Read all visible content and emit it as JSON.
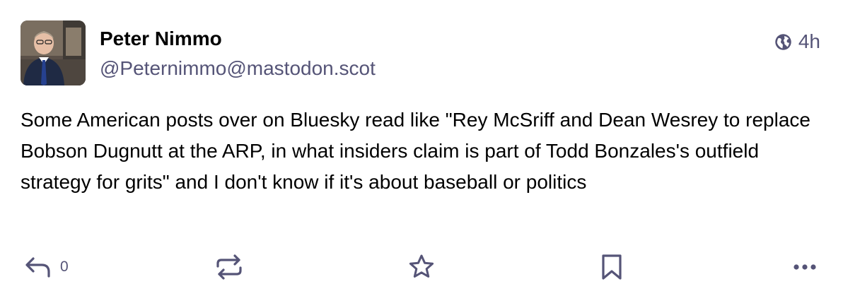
{
  "post": {
    "author": {
      "display_name": "Peter Nimmo",
      "handle": "@Peternimmo@mastodon.scot",
      "avatar_icon": "profile-photo"
    },
    "visibility_icon": "globe-icon",
    "timestamp": "4h",
    "content": "Some American posts over on Bluesky read like \"Rey McSriff and Dean Wesrey to replace Bobson Dugnutt at the ARP, in what insiders claim is part of Todd Bonzales's outfield strategy for grits\" and I don't know if it's about baseball or politics",
    "actions": {
      "reply_count": "0",
      "reply_icon": "reply-icon",
      "boost_icon": "boost-icon",
      "favourite_icon": "star-icon",
      "bookmark_icon": "bookmark-icon",
      "more_icon": "more-icon"
    }
  },
  "colors": {
    "text": "#000000",
    "secondary": "#555477",
    "background": "#ffffff"
  }
}
